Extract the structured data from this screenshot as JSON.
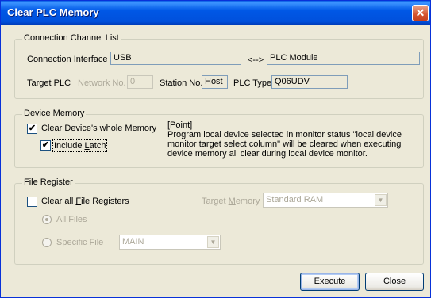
{
  "window": {
    "title": "Clear PLC Memory",
    "close_glyph": "✕"
  },
  "connection": {
    "group_label": "Connection Channel List",
    "interface_label": "Connection Interface",
    "interface_value": "USB",
    "arrow": "<-->",
    "target_value": "PLC Module",
    "target_plc_label": "Target PLC",
    "network_label": "Network No.",
    "network_value": "0",
    "station_label": "Station No.",
    "station_value": "Host",
    "plc_type_label": "PLC Type",
    "plc_type_value": "Q06UDV"
  },
  "device_memory": {
    "group_label": "Device Memory",
    "clear_whole": {
      "pre": "Clear ",
      "key": "D",
      "post": "evice's whole Memory",
      "checked": true
    },
    "include_latch": {
      "pre": "Include ",
      "key": "L",
      "post": "atch",
      "checked": true
    },
    "point_title": "[Point]",
    "point_text": "Program local device selected in monitor status \"local device monitor target select column\" will be cleared when executing device memory all clear during local device monitor."
  },
  "file_register": {
    "group_label": "File Register",
    "clear_all": {
      "pre": "Clear all ",
      "key": "F",
      "post": "ile Registers",
      "checked": false
    },
    "target_memory": {
      "pre": "Target ",
      "key": "M",
      "post": "emory",
      "value": "Standard RAM"
    },
    "all_files": {
      "key": "A",
      "post": "ll Files",
      "selected": true
    },
    "specific_file": {
      "key": "S",
      "post": "pecific File",
      "value": "MAIN"
    }
  },
  "buttons": {
    "execute": {
      "key": "E",
      "post": "xecute"
    },
    "close": "Close"
  },
  "icons": {
    "checkmark": "✔",
    "dropdown": "▼"
  }
}
